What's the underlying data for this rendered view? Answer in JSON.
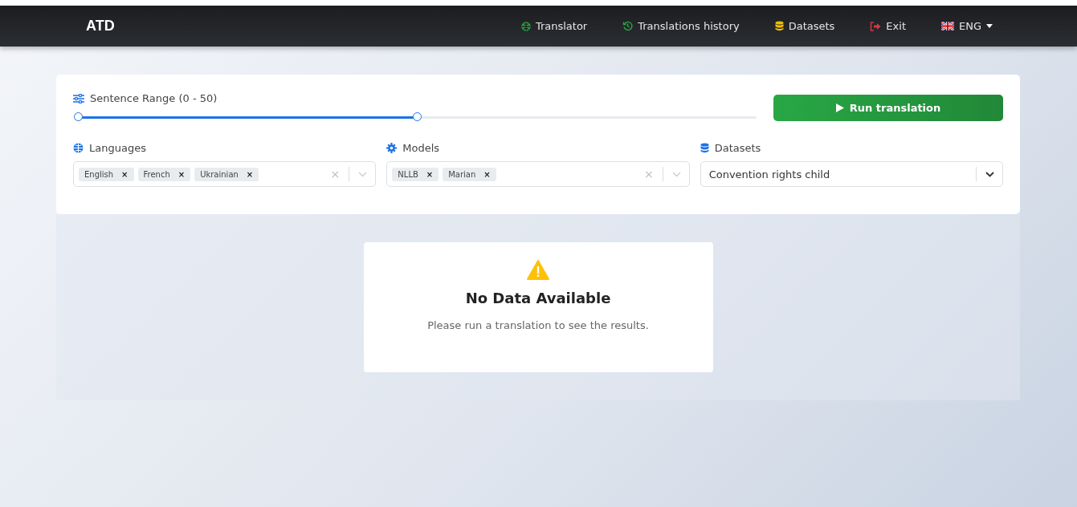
{
  "navbar": {
    "brand": "ATD",
    "links": [
      {
        "label": "Translator"
      },
      {
        "label": "Translations history"
      },
      {
        "label": "Datasets"
      },
      {
        "label": "Exit"
      }
    ],
    "language": {
      "label": "ENG"
    }
  },
  "form": {
    "range": {
      "label": "Sentence Range (0 - 50)",
      "start": {
        "level": 0
      },
      "end": {
        "level": 0.5
      }
    },
    "run_button": "Run translation",
    "fields": [
      {
        "label": "Languages",
        "kind": "multi",
        "chips": [
          {
            "label": "English",
            "remove": "×"
          },
          {
            "label": "French",
            "remove": "×"
          },
          {
            "label": "Ukrainian",
            "remove": "×"
          }
        ],
        "clear": "×"
      },
      {
        "label": "Models",
        "kind": "multi",
        "chips": [
          {
            "label": "NLLB",
            "remove": "×"
          },
          {
            "label": "Marian",
            "remove": "×"
          }
        ],
        "clear": "×"
      },
      {
        "label": "Datasets",
        "kind": "single",
        "value": "Convention rights child"
      }
    ]
  },
  "empty_state": {
    "title": "No Data Available",
    "message": "Please run a translation to see the results."
  }
}
